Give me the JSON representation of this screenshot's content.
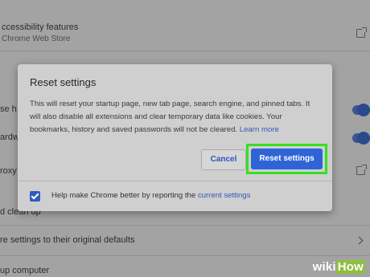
{
  "background": {
    "rows": [
      {
        "title": "ccessibility features",
        "subtitle": "Chrome Web Store"
      },
      {
        "title": "se h"
      },
      {
        "title": "ardw"
      },
      {
        "title": "roxy"
      },
      {
        "title": "d clean up"
      },
      {
        "title": "re settings to their original defaults"
      },
      {
        "title": "up computer"
      }
    ]
  },
  "dialog": {
    "title": "Reset settings",
    "body": "This will reset your startup page, new tab page, search engine, and pinned tabs. It will also disable all extensions and clear temporary data like cookies. Your bookmarks, history and saved passwords will not be cleared.",
    "learn_more": "Learn more",
    "cancel_label": "Cancel",
    "reset_label": "Reset settings",
    "checkbox_checked": true,
    "checkbox_text": "Help make Chrome better by reporting the",
    "checkbox_link": "current settings"
  },
  "colors": {
    "accent": "#2f64d8",
    "highlight": "#35e020"
  },
  "watermark": {
    "part1": "wiki",
    "part2": "How"
  }
}
